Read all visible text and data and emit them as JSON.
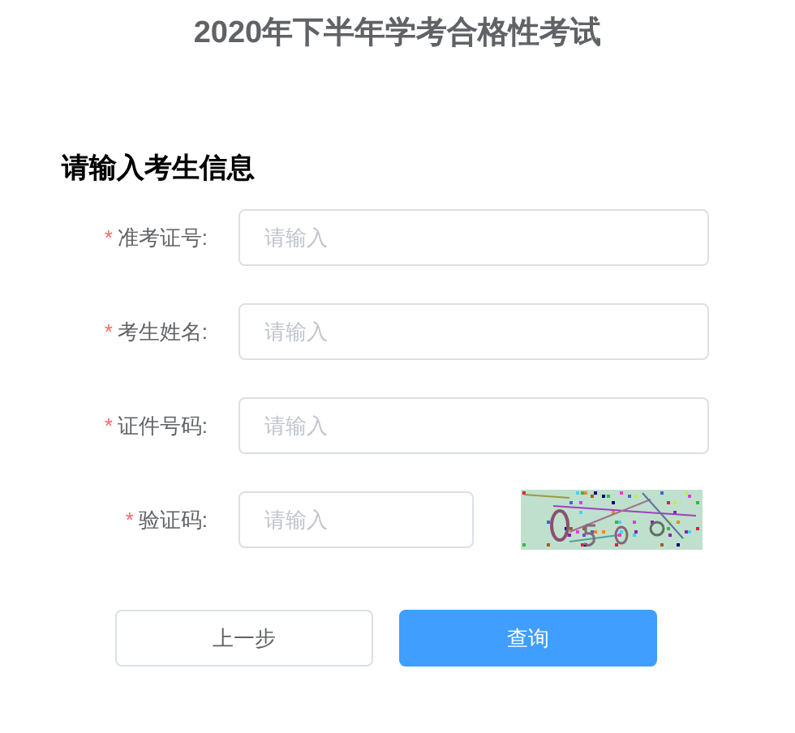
{
  "title": "2020年下半年学考合格性考试",
  "section_title": "请输入考生信息",
  "fields": [
    {
      "kind": "text",
      "required_mark": "*",
      "label": "准考证号:",
      "placeholder": "请输入"
    },
    {
      "kind": "text",
      "required_mark": "*",
      "label": "考生姓名:",
      "placeholder": "请输入"
    },
    {
      "kind": "text",
      "required_mark": "*",
      "label": "证件号码:",
      "placeholder": "请输入"
    },
    {
      "kind": "captcha",
      "required_mark": "*",
      "label": "验证码:",
      "placeholder": "请输入"
    }
  ],
  "buttons": [
    {
      "label": "上一步",
      "kind": "secondary"
    },
    {
      "label": "查询",
      "kind": "primary"
    }
  ]
}
